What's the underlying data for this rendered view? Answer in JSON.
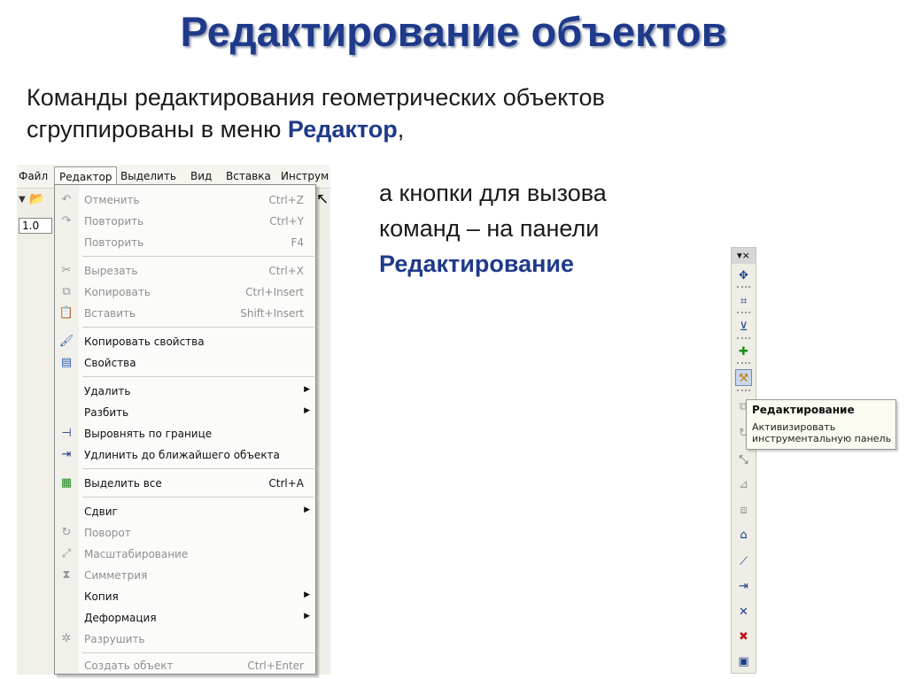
{
  "slide": {
    "title": "Редактирование объектов",
    "intro_line1": "Команды редактирования геометрических объектов",
    "intro_line2_pre": "сгруппированы в меню ",
    "intro_line2_hl": "Редактор",
    "intro_line2_post": ",",
    "aside_line1": "а кнопки для вызова",
    "aside_line2": "команд – на панели",
    "aside_hl": "Редактирование"
  },
  "menubar": {
    "items": [
      "Файл",
      "Редактор",
      "Выделить",
      "Вид",
      "Вставка",
      "Инструм"
    ]
  },
  "toolbar": {
    "scale_value": "1.0"
  },
  "editor_menu": {
    "items": [
      {
        "label": "Отменить",
        "shortcut": "Ctrl+Z",
        "icon": "undo-icon"
      },
      {
        "label": "Повторить",
        "shortcut": "Ctrl+Y",
        "icon": "redo-icon"
      },
      {
        "label": "Повторить",
        "shortcut": "F4",
        "icon": ""
      },
      {
        "label": "Вырезать",
        "shortcut": "Ctrl+X",
        "icon": "scissors-icon"
      },
      {
        "label": "Копировать",
        "shortcut": "Ctrl+Insert",
        "icon": "copy-icon"
      },
      {
        "label": "Вставить",
        "shortcut": "Shift+Insert",
        "icon": "paste-icon"
      },
      {
        "label": "Копировать свойства",
        "shortcut": "",
        "icon": "brush-icon"
      },
      {
        "label": "Свойства",
        "shortcut": "",
        "icon": "properties-icon"
      },
      {
        "label": "Удалить",
        "shortcut": "",
        "icon": ""
      },
      {
        "label": "Разбить",
        "shortcut": "",
        "icon": ""
      },
      {
        "label": "Выровнять по границе",
        "shortcut": "",
        "icon": "align-boundary-icon"
      },
      {
        "label": "Удлинить до ближайшего объекта",
        "shortcut": "",
        "icon": "extend-icon"
      },
      {
        "label": "Выделить все",
        "shortcut": "Ctrl+A",
        "icon": "select-all-icon"
      },
      {
        "label": "Сдвиг",
        "shortcut": "",
        "icon": ""
      },
      {
        "label": "Поворот",
        "shortcut": "",
        "icon": "rotate-icon"
      },
      {
        "label": "Масштабирование",
        "shortcut": "",
        "icon": "scale-icon"
      },
      {
        "label": "Симметрия",
        "shortcut": "",
        "icon": "mirror-icon"
      },
      {
        "label": "Копия",
        "shortcut": "",
        "icon": ""
      },
      {
        "label": "Деформация",
        "shortcut": "",
        "icon": ""
      },
      {
        "label": "Разрушить",
        "shortcut": "",
        "icon": "explode-icon"
      },
      {
        "label": "Создать объект",
        "shortcut": "Ctrl+Enter",
        "icon": ""
      }
    ]
  },
  "edit_toolbar": {
    "header_glyph": "▾×",
    "tooltip_title": "Редактирование",
    "tooltip_body": "Активизировать инструментальную панель"
  }
}
